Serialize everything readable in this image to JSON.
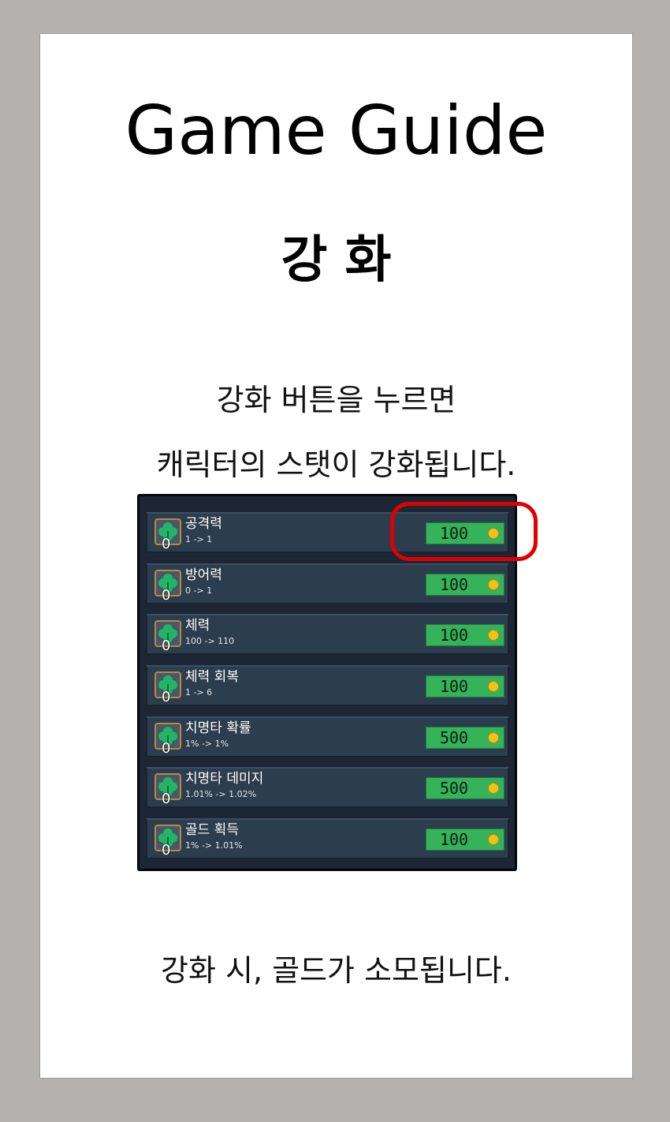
{
  "title": "Game Guide",
  "subtitle": "강 화",
  "description": [
    "강화 버튼을 누르면",
    "캐릭터의 스탯이 강화됩니다."
  ],
  "footer_text": "강화 시, 골드가 소모됩니다.",
  "colors": {
    "highlight": "#e00000",
    "price_button": "#35b35a",
    "panel_bg": "#1c2634",
    "row_bg": "#2c3d4e",
    "coin": "#f2c21c"
  },
  "upgrades": [
    {
      "name": "공격력",
      "change": "1 -> 1",
      "level": "0",
      "cost": "100",
      "icon": "clover-icon",
      "cost_icon": "gold-coin-icon"
    },
    {
      "name": "방어력",
      "change": "0 -> 1",
      "level": "0",
      "cost": "100",
      "icon": "clover-icon",
      "cost_icon": "gold-coin-icon"
    },
    {
      "name": "체력",
      "change": "100 -> 110",
      "level": "0",
      "cost": "100",
      "icon": "clover-icon",
      "cost_icon": "gold-coin-icon"
    },
    {
      "name": "체력 회복",
      "change": "1 -> 6",
      "level": "0",
      "cost": "100",
      "icon": "clover-icon",
      "cost_icon": "gold-coin-icon"
    },
    {
      "name": "치명타 확률",
      "change": "1% -> 1%",
      "level": "0",
      "cost": "500",
      "icon": "clover-icon",
      "cost_icon": "gold-coin-icon"
    },
    {
      "name": "치명타 데미지",
      "change": "1.01% -> 1.02%",
      "level": "0",
      "cost": "500",
      "icon": "clover-icon",
      "cost_icon": "gold-coin-icon"
    },
    {
      "name": "골드 획득",
      "change": "1% -> 1.01%",
      "level": "0",
      "cost": "100",
      "icon": "clover-icon",
      "cost_icon": "gold-coin-icon"
    }
  ]
}
